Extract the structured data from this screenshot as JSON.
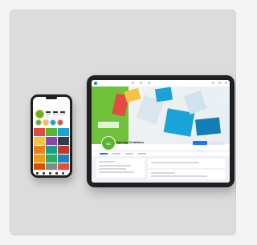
{
  "tablet": {
    "page_name": "Speedy Creations",
    "page_subtitle": "",
    "follow_label": "",
    "message_label": "",
    "profile_initials": "SC",
    "colors": {
      "brand_green": "#58b530",
      "facebook_blue": "#1877f2",
      "cover_green": "#6fc23a",
      "cover_blue": "#1aa3d9",
      "cover_red": "#e34b3e",
      "cover_yellow": "#f5c242"
    }
  },
  "phone": {
    "status_time": "",
    "profile_colors": [
      "#58b530",
      "#f9a825"
    ],
    "grid_colors": [
      "#e34b3e",
      "#58b530",
      "#1aa3d9",
      "#f5c242",
      "#8e44ad",
      "#2c3e50",
      "#e67e22",
      "#16a085",
      "#c0392b",
      "#f39c12",
      "#27ae60",
      "#2980b9",
      "#d35400",
      "#7f8c8d",
      "#e74c3c",
      "#1abc9c",
      "#9b59b6",
      "#34495e"
    ]
  },
  "icons": [
    "facebook-logo-icon",
    "instagram-home-icon",
    "search-icon",
    "add-icon",
    "heart-icon",
    "profile-icon"
  ]
}
